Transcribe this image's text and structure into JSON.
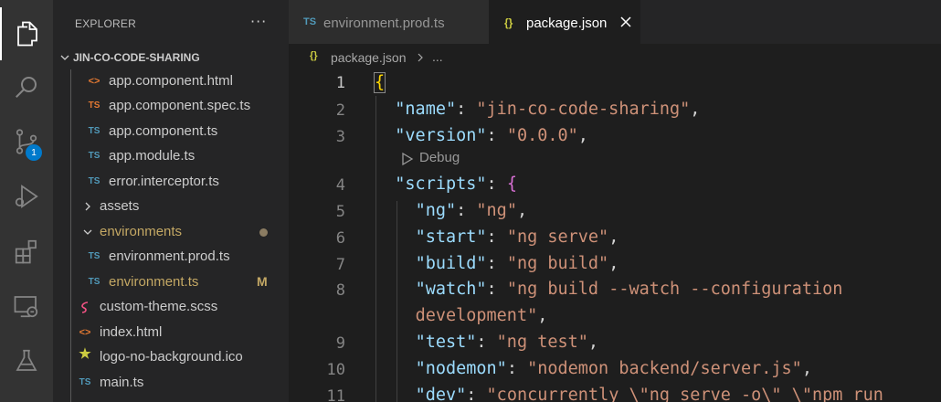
{
  "activity_bar": {
    "items": [
      {
        "name": "explorer",
        "icon": "files-icon"
      },
      {
        "name": "search",
        "icon": "search-icon"
      },
      {
        "name": "source-control",
        "icon": "source-control-icon",
        "badge": "1"
      },
      {
        "name": "run-debug",
        "icon": "run-debug-icon"
      },
      {
        "name": "extensions",
        "icon": "extensions-icon"
      },
      {
        "name": "remote-explorer",
        "icon": "remote-explorer-icon"
      },
      {
        "name": "testing",
        "icon": "testing-flask-icon"
      }
    ]
  },
  "sidebar": {
    "title": "EXPLORER",
    "more": "···",
    "section": "JIN-CO-CODE-SHARING",
    "items": [
      {
        "label": "app.component.html",
        "icon": "<>",
        "type": "html"
      },
      {
        "label": "app.component.spec.ts",
        "icon": "TS",
        "type": "ts"
      },
      {
        "label": "app.component.ts",
        "icon": "TS",
        "type": "ts"
      },
      {
        "label": "app.module.ts",
        "icon": "TS",
        "type": "ts"
      },
      {
        "label": "error.interceptor.ts",
        "icon": "TS",
        "type": "ts"
      },
      {
        "label": "assets",
        "type": "folder-collapsed"
      },
      {
        "label": "environments",
        "type": "folder-expanded",
        "status": "modified-dot"
      },
      {
        "label": "environment.prod.ts",
        "icon": "TS",
        "type": "ts"
      },
      {
        "label": "environment.ts",
        "icon": "TS",
        "type": "ts",
        "status": "M"
      },
      {
        "label": "custom-theme.scss",
        "icon": "scss",
        "type": "scss"
      },
      {
        "label": "index.html",
        "icon": "<>",
        "type": "html"
      },
      {
        "label": "logo-no-background.ico",
        "icon": "★",
        "type": "ico"
      },
      {
        "label": "main.ts",
        "icon": "TS",
        "type": "ts"
      }
    ]
  },
  "tabs": [
    {
      "label": "environment.prod.ts",
      "icon": "TS",
      "active": false
    },
    {
      "label": "package.json",
      "icon": "{}",
      "active": true
    }
  ],
  "breadcrumb": {
    "icon": "{}",
    "file": "package.json",
    "more": "..."
  },
  "editor": {
    "codelens": "Debug",
    "lines": [
      {
        "num": "1"
      },
      {
        "num": "2",
        "key": "\"name\"",
        "value": "\"jin-co-code-sharing\""
      },
      {
        "num": "3",
        "key": "\"version\"",
        "value": "\"0.0.0\""
      },
      {
        "num": "4",
        "key": "\"scripts\""
      },
      {
        "num": "5",
        "key": "\"ng\"",
        "value": "\"ng\""
      },
      {
        "num": "6",
        "key": "\"start\"",
        "value": "\"ng serve\""
      },
      {
        "num": "7",
        "key": "\"build\"",
        "value": "\"ng build\""
      },
      {
        "num": "8",
        "key": "\"watch\"",
        "value": "\"ng build --watch --configuration",
        "value_cont": "development\""
      },
      {
        "num": "9",
        "key": "\"test\"",
        "value": "\"ng test\""
      },
      {
        "num": "10",
        "key": "\"nodemon\"",
        "value": "\"nodemon backend/server.js\""
      },
      {
        "num": "11",
        "key": "\"dev\"",
        "value": "\"concurrently \\\"ng serve -o\\\" \\\"npm run"
      }
    ]
  },
  "colors": {
    "activity_bar": "#333333",
    "sidebar": "#252526",
    "editor": "#1e1e1e",
    "json_key": "#9cdcfe",
    "json_string": "#ce9178",
    "bracket_level1": "#ffd700",
    "bracket_level2": "#da70d6",
    "badge": "#007acc"
  }
}
